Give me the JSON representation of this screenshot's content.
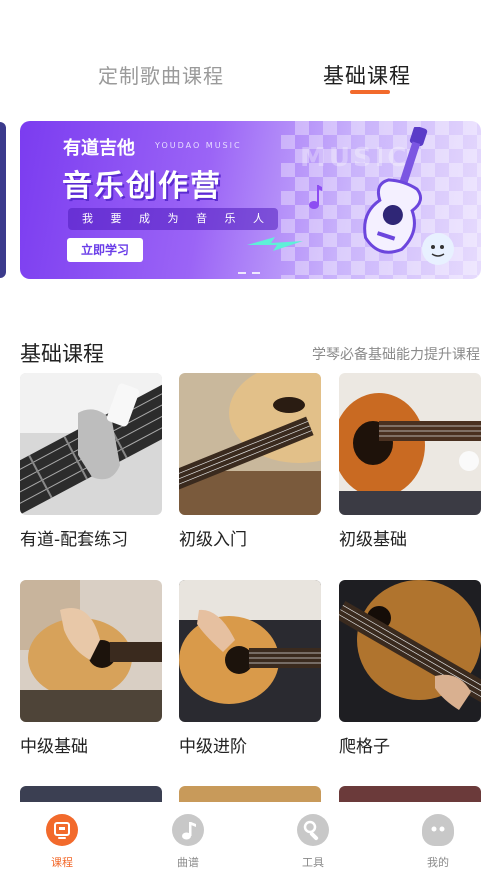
{
  "top_tabs": {
    "custom": "定制歌曲课程",
    "basic": "基础课程",
    "active": "basic"
  },
  "banner": {
    "brand": "有道吉他",
    "brand_en": "YOUDAO MUSIC",
    "title": "音乐创作营",
    "music_text": "MUSIC",
    "slogan": "我 要 成 为 音 乐 人",
    "button": "立即学习"
  },
  "section": {
    "title": "基础课程",
    "subtitle": "学琴必备基础能力提升课程"
  },
  "courses": [
    {
      "label": "有道-配套练习"
    },
    {
      "label": "初级入门"
    },
    {
      "label": "初级基础"
    },
    {
      "label": "中级基础"
    },
    {
      "label": "中级进阶"
    },
    {
      "label": "爬格子"
    }
  ],
  "bottom_nav": {
    "items": [
      {
        "label": "课程",
        "icon": "course-icon",
        "active": true
      },
      {
        "label": "曲谱",
        "icon": "music-note-icon",
        "active": false
      },
      {
        "label": "工具",
        "icon": "wrench-icon",
        "active": false
      },
      {
        "label": "我的",
        "icon": "profile-icon",
        "active": false
      }
    ]
  },
  "colors": {
    "accent": "#f26a2c",
    "banner_purple": "#7b3cf0",
    "inactive": "#c8c8c8"
  }
}
